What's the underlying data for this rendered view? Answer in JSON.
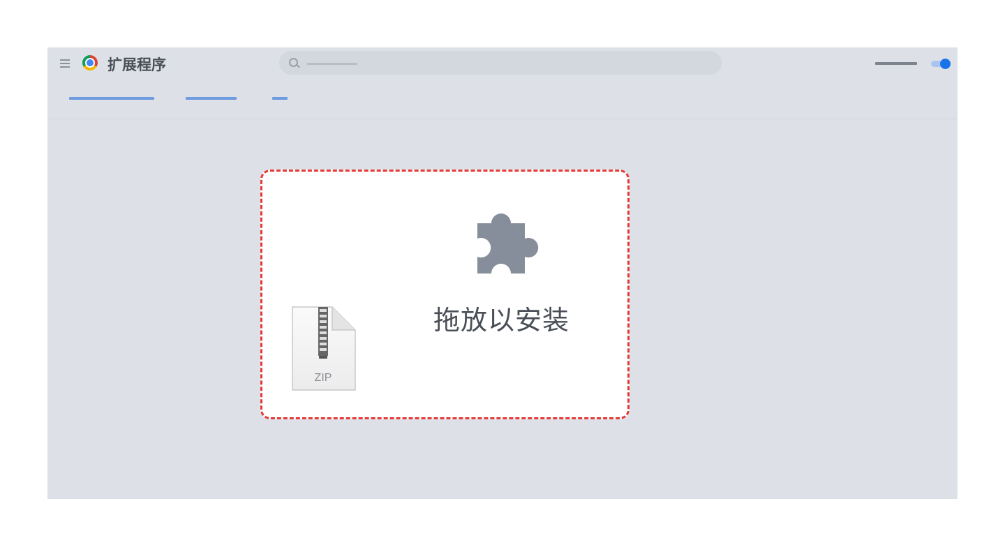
{
  "header": {
    "title": "扩展程序",
    "menu_icon": "hamburger-menu-icon",
    "logo_icon": "chrome-logo-icon",
    "search": {
      "icon": "search-icon"
    },
    "developer_mode": {
      "enabled": true
    }
  },
  "toolbar": {
    "link_count": 3
  },
  "drop_zone": {
    "message": "拖放以安装",
    "icon": "puzzle-piece-icon",
    "file": {
      "type_label": "ZIP",
      "icon": "zip-file-icon"
    }
  },
  "colors": {
    "page_background": "#dde1e7",
    "accent_blue": "#1a73e8",
    "drop_zone_border": "#e53935",
    "puzzle_icon": "#868e9b"
  }
}
